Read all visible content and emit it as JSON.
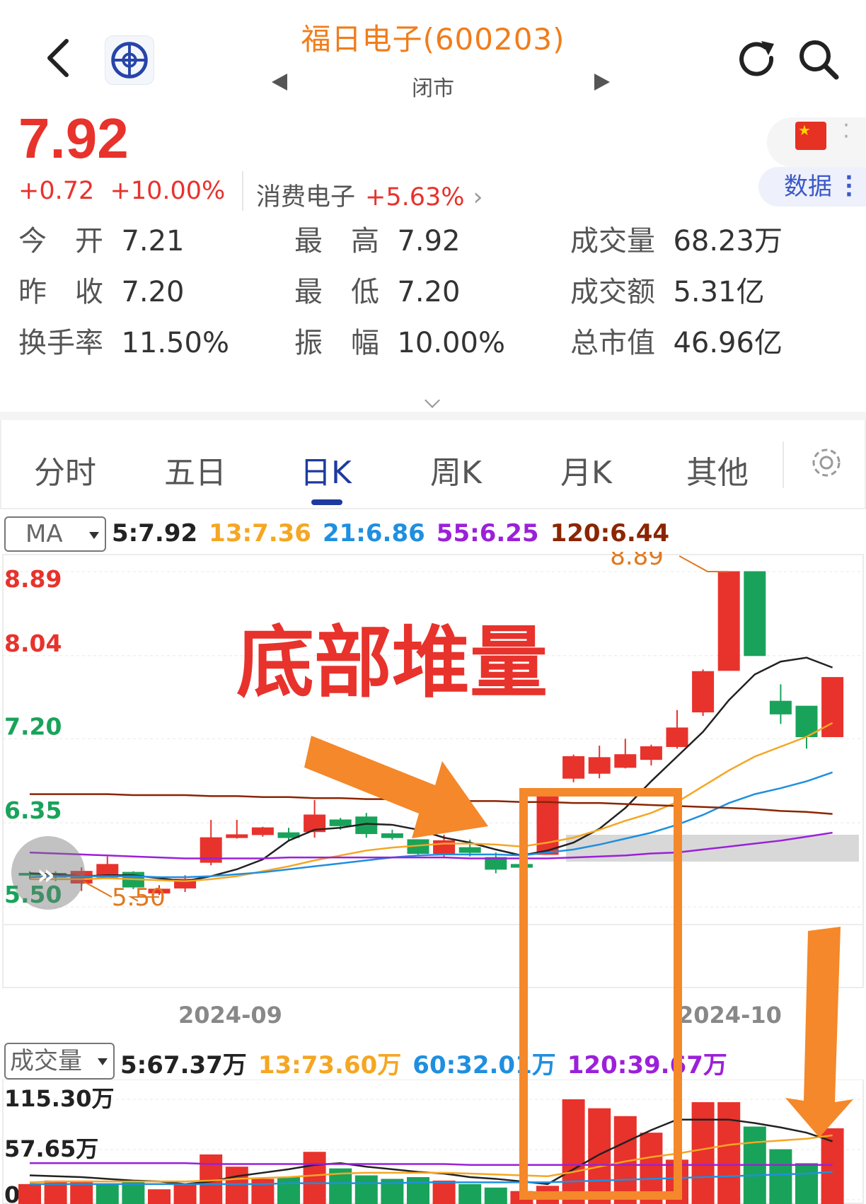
{
  "header": {
    "title": "福日电子(600203)",
    "status": "闭市",
    "back_icon": "chevron-left-icon",
    "refresh_icon": "refresh-icon",
    "search_icon": "search-icon"
  },
  "quote": {
    "price": "7.92",
    "change": "+0.72",
    "change_pct": "+10.00%",
    "sector_name": "消费电子",
    "sector_pct": "+5.63%",
    "data_button": "数据",
    "colors": {
      "up": "#e8322c",
      "down": "#19a35a",
      "brand": "#f07d1b",
      "active": "#1f3a9e"
    }
  },
  "stats": [
    {
      "label": "今　开",
      "value": "7.21"
    },
    {
      "label": "昨　收",
      "value": "7.20"
    },
    {
      "label": "换手率",
      "value": "11.50%"
    },
    {
      "label": "最　高",
      "value": "7.92"
    },
    {
      "label": "最　低",
      "value": "7.20"
    },
    {
      "label": "振　幅",
      "value": "10.00%"
    },
    {
      "label": "成交量",
      "value": "68.23万"
    },
    {
      "label": "成交额",
      "value": "5.31亿"
    },
    {
      "label": "总市值",
      "value": "46.96亿"
    }
  ],
  "tabs": [
    "分时",
    "五日",
    "日K",
    "周K",
    "月K",
    "其他"
  ],
  "active_tab": "日K",
  "ma": {
    "selector": "MA",
    "items": [
      {
        "text": "5:7.92",
        "color": "#222222"
      },
      {
        "text": "13:7.36",
        "color": "#f5a623"
      },
      {
        "text": "21:6.86",
        "color": "#1f8fe0"
      },
      {
        "text": "55:6.25",
        "color": "#9b20d9"
      },
      {
        "text": "120:6.44",
        "color": "#8b2500"
      }
    ]
  },
  "volume_indicator": {
    "selector": "成交量",
    "items": [
      {
        "text": "5:67.37万",
        "color": "#222222"
      },
      {
        "text": "13:73.60万",
        "color": "#f5a623"
      },
      {
        "text": "60:32.01万",
        "color": "#1f8fe0"
      },
      {
        "text": "120:39.67万",
        "color": "#9b20d9"
      }
    ]
  },
  "chart_data": {
    "type": "candlestick",
    "y_ticks": [
      "8.89",
      "8.04",
      "7.20",
      "6.35",
      "5.50"
    ],
    "ylim": [
      5.5,
      8.89
    ],
    "x_labels": [
      "2024-09",
      "2024-10"
    ],
    "high_marker": "8.89",
    "low_marker": "5.50",
    "annotation": "底部堆量",
    "candles": [
      {
        "o": 5.84,
        "c": 5.82,
        "h": 5.86,
        "l": 5.78
      },
      {
        "o": 5.84,
        "c": 5.8,
        "h": 5.86,
        "l": 5.76
      },
      {
        "o": 5.74,
        "c": 5.86,
        "h": 5.9,
        "l": 5.66
      },
      {
        "o": 5.8,
        "c": 5.93,
        "h": 6.01,
        "l": 5.78
      },
      {
        "o": 5.85,
        "c": 5.7,
        "h": 5.86,
        "l": 5.68
      },
      {
        "o": 5.64,
        "c": 5.68,
        "h": 5.72,
        "l": 5.62
      },
      {
        "o": 5.69,
        "c": 5.78,
        "h": 5.82,
        "l": 5.65
      },
      {
        "o": 5.95,
        "c": 6.2,
        "h": 6.38,
        "l": 5.92
      },
      {
        "o": 6.2,
        "c": 6.23,
        "h": 6.38,
        "l": 6.19
      },
      {
        "o": 6.23,
        "c": 6.3,
        "h": 6.31,
        "l": 6.21
      },
      {
        "o": 6.25,
        "c": 6.2,
        "h": 6.3,
        "l": 6.17
      },
      {
        "o": 6.26,
        "c": 6.43,
        "h": 6.58,
        "l": 6.2
      },
      {
        "o": 6.38,
        "c": 6.32,
        "h": 6.4,
        "l": 6.28
      },
      {
        "o": 6.41,
        "c": 6.24,
        "h": 6.45,
        "l": 6.2
      },
      {
        "o": 6.24,
        "c": 6.2,
        "h": 6.28,
        "l": 6.18
      },
      {
        "o": 6.18,
        "c": 6.04,
        "h": 6.18,
        "l": 6.03
      },
      {
        "o": 6.04,
        "c": 6.17,
        "h": 6.23,
        "l": 5.99
      },
      {
        "o": 6.1,
        "c": 6.05,
        "h": 6.18,
        "l": 6.01
      },
      {
        "o": 6.0,
        "c": 5.88,
        "h": 6.05,
        "l": 5.84
      },
      {
        "o": 5.93,
        "c": 5.9,
        "h": 6.0,
        "l": 5.87
      },
      {
        "o": 6.03,
        "c": 6.63,
        "h": 6.63,
        "l": 6.03
      },
      {
        "o": 6.8,
        "c": 7.02,
        "h": 7.04,
        "l": 6.76
      },
      {
        "o": 6.85,
        "c": 7.01,
        "h": 7.13,
        "l": 6.8
      },
      {
        "o": 6.91,
        "c": 7.04,
        "h": 7.2,
        "l": 6.9
      },
      {
        "o": 6.99,
        "c": 7.12,
        "h": 7.14,
        "l": 6.93
      },
      {
        "o": 7.12,
        "c": 7.31,
        "h": 7.49,
        "l": 7.1
      },
      {
        "o": 7.47,
        "c": 7.88,
        "h": 7.9,
        "l": 7.43
      },
      {
        "o": 7.89,
        "c": 8.89,
        "h": 8.89,
        "l": 7.89
      },
      {
        "o": 8.89,
        "c": 8.04,
        "h": 8.89,
        "l": 8.04
      },
      {
        "o": 7.58,
        "c": 7.45,
        "h": 7.75,
        "l": 7.35
      },
      {
        "o": 7.53,
        "c": 7.22,
        "h": 7.53,
        "l": 7.1
      },
      {
        "o": 7.22,
        "c": 7.82,
        "h": 7.82,
        "l": 7.22
      }
    ],
    "ma_series": [
      {
        "name": "5",
        "color": "#222222",
        "values": [
          5.84,
          5.83,
          5.81,
          5.82,
          5.82,
          5.79,
          5.76,
          5.81,
          5.88,
          5.98,
          6.17,
          6.28,
          6.3,
          6.34,
          6.33,
          6.28,
          6.2,
          6.15,
          6.08,
          6.02,
          6.07,
          6.15,
          6.29,
          6.5,
          6.77,
          7.02,
          7.27,
          7.59,
          7.85,
          7.98,
          8.02,
          7.92
        ]
      },
      {
        "name": "13",
        "color": "#f5a623",
        "values": [
          5.78,
          5.78,
          5.78,
          5.79,
          5.78,
          5.77,
          5.76,
          5.78,
          5.81,
          5.86,
          5.91,
          5.97,
          6.02,
          6.07,
          6.1,
          6.12,
          6.14,
          6.14,
          6.13,
          6.11,
          6.15,
          6.2,
          6.28,
          6.37,
          6.45,
          6.56,
          6.72,
          6.88,
          7.02,
          7.12,
          7.22,
          7.36
        ]
      },
      {
        "name": "21",
        "color": "#1f8fe0",
        "values": [
          5.8,
          5.81,
          5.81,
          5.81,
          5.81,
          5.8,
          5.8,
          5.81,
          5.83,
          5.85,
          5.88,
          5.91,
          5.94,
          5.97,
          6.0,
          6.02,
          6.03,
          6.03,
          6.03,
          6.02,
          6.05,
          6.08,
          6.13,
          6.19,
          6.25,
          6.33,
          6.43,
          6.55,
          6.64,
          6.7,
          6.77,
          6.86
        ]
      },
      {
        "name": "55",
        "color": "#9b20d9",
        "values": [
          6.05,
          6.04,
          6.03,
          6.02,
          6.01,
          6.0,
          5.99,
          5.99,
          5.99,
          5.99,
          6.0,
          6.0,
          6.0,
          6.0,
          6.0,
          6.0,
          6.0,
          5.99,
          5.99,
          5.99,
          5.99,
          6.0,
          6.01,
          6.02,
          6.04,
          6.05,
          6.08,
          6.11,
          6.14,
          6.17,
          6.21,
          6.25
        ]
      },
      {
        "name": "120",
        "color": "#8b2500",
        "values": [
          6.64,
          6.64,
          6.64,
          6.64,
          6.63,
          6.63,
          6.63,
          6.62,
          6.62,
          6.61,
          6.61,
          6.6,
          6.6,
          6.59,
          6.59,
          6.58,
          6.58,
          6.57,
          6.57,
          6.56,
          6.56,
          6.55,
          6.55,
          6.54,
          6.53,
          6.52,
          6.51,
          6.5,
          6.49,
          6.47,
          6.46,
          6.44
        ]
      }
    ],
    "volume": {
      "y_ticks": [
        "115.30万",
        "57.65万",
        "0"
      ],
      "ylim": [
        0,
        115.3
      ],
      "bars": [
        {
          "v": 18,
          "up": true
        },
        {
          "v": 22,
          "up": true
        },
        {
          "v": 22,
          "up": true
        },
        {
          "v": 18,
          "up": false
        },
        {
          "v": 22,
          "up": false
        },
        {
          "v": 12,
          "up": true
        },
        {
          "v": 18,
          "up": true
        },
        {
          "v": 52,
          "up": true
        },
        {
          "v": 38,
          "up": true
        },
        {
          "v": 24,
          "up": true
        },
        {
          "v": 26,
          "up": false
        },
        {
          "v": 55,
          "up": true
        },
        {
          "v": 36,
          "up": false
        },
        {
          "v": 28,
          "up": false
        },
        {
          "v": 24,
          "up": false
        },
        {
          "v": 26,
          "up": false
        },
        {
          "v": 22,
          "up": true
        },
        {
          "v": 18,
          "up": false
        },
        {
          "v": 14,
          "up": false
        },
        {
          "v": 10,
          "up": true
        },
        {
          "v": 16,
          "up": true
        },
        {
          "v": 115.3,
          "up": true
        },
        {
          "v": 105,
          "up": true
        },
        {
          "v": 96,
          "up": true
        },
        {
          "v": 77,
          "up": true
        },
        {
          "v": 46,
          "up": true
        },
        {
          "v": 112,
          "up": true
        },
        {
          "v": 112,
          "up": true
        },
        {
          "v": 84,
          "up": false
        },
        {
          "v": 58,
          "up": false
        },
        {
          "v": 42,
          "up": false
        },
        {
          "v": 82,
          "up": true
        }
      ],
      "ma_series": [
        {
          "name": "5",
          "color": "#222222",
          "values": [
            28,
            27,
            26,
            24,
            22,
            21,
            18,
            21,
            27,
            31,
            35,
            40,
            42,
            38,
            35,
            32,
            30,
            26,
            24,
            21,
            18,
            35,
            52,
            66,
            80,
            92,
            92,
            92,
            88,
            83,
            77,
            67
          ]
        },
        {
          "name": "13",
          "color": "#f5a623",
          "values": [
            20,
            21,
            21,
            21,
            21,
            21,
            21,
            22,
            24,
            25,
            26,
            28,
            30,
            31,
            31,
            31,
            31,
            30,
            29,
            28,
            27,
            32,
            38,
            44,
            49,
            53,
            58,
            63,
            66,
            68,
            70,
            74
          ]
        },
        {
          "name": "60",
          "color": "#1f8fe0",
          "values": [
            18,
            18,
            18,
            18,
            18,
            18,
            18,
            18,
            18,
            18,
            19,
            19,
            19,
            19,
            19,
            20,
            20,
            20,
            20,
            20,
            20,
            21,
            22,
            23,
            24,
            25,
            26,
            27,
            28,
            29,
            30,
            32
          ]
        },
        {
          "name": "120",
          "color": "#9b20d9",
          "values": [
            42,
            42,
            42,
            42,
            42,
            42,
            42,
            41,
            41,
            41,
            41,
            41,
            41,
            41,
            41,
            41,
            41,
            40,
            40,
            40,
            40,
            40,
            40,
            40,
            40,
            40,
            40,
            40,
            40,
            40,
            40,
            40
          ]
        }
      ]
    }
  }
}
